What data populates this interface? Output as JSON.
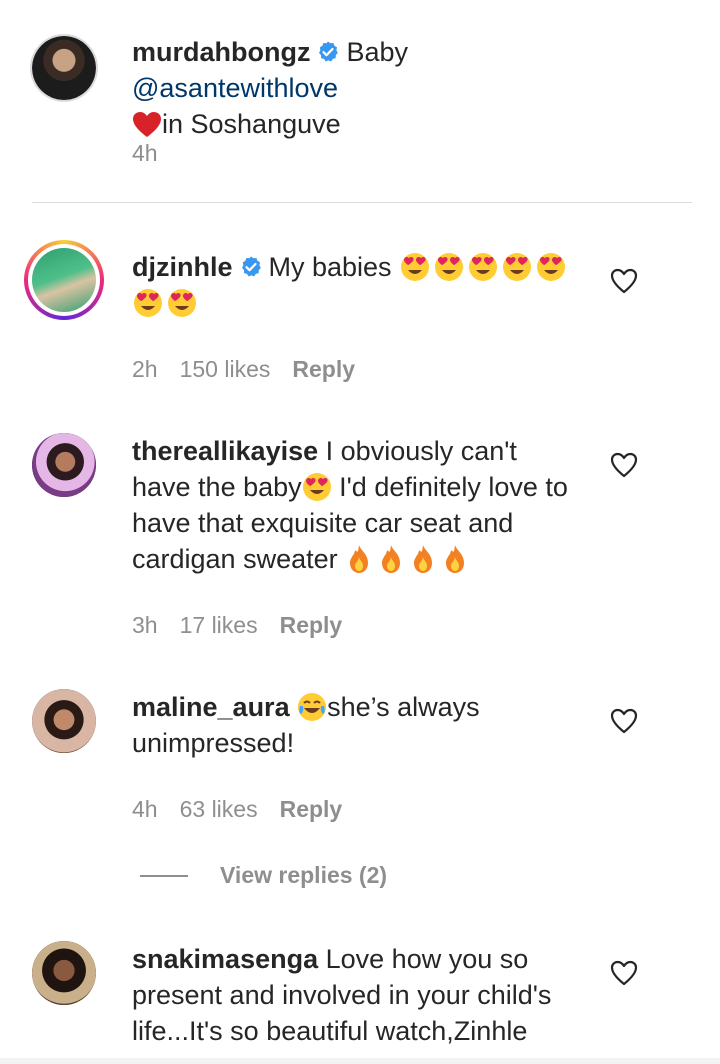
{
  "caption": {
    "username": "murdahbongz",
    "text_before": "Baby ",
    "mention": "@asantewithlove",
    "text_after": "in Soshanguve",
    "time": "4h"
  },
  "comments": [
    {
      "username": "djzinhle",
      "verified": true,
      "text": "My babies",
      "emoji_count": 7,
      "time": "2h",
      "likes": "150 likes",
      "reply_label": "Reply"
    },
    {
      "username": "thereallikayise",
      "text_part1": "I obviously can't have the baby",
      "text_part2": " I'd definitely love to have that exquisite car seat and cardigan sweater ",
      "time": "3h",
      "likes": "17 likes",
      "reply_label": "Reply"
    },
    {
      "username": "maline_aura",
      "text": "she’s always unimpressed!",
      "time": "4h",
      "likes": "63 likes",
      "reply_label": "Reply",
      "view_replies": "View replies (2)"
    },
    {
      "username": "snakimasenga",
      "text": "Love how you so present and involved in your child's life...It's so beautiful watch,Zinhle"
    }
  ],
  "icons": {
    "verified": "verified-badge-icon",
    "like": "heart-outline-icon"
  },
  "colors": {
    "verified": "#3897f0",
    "mention": "#00376b",
    "muted": "#8e8e8e"
  }
}
